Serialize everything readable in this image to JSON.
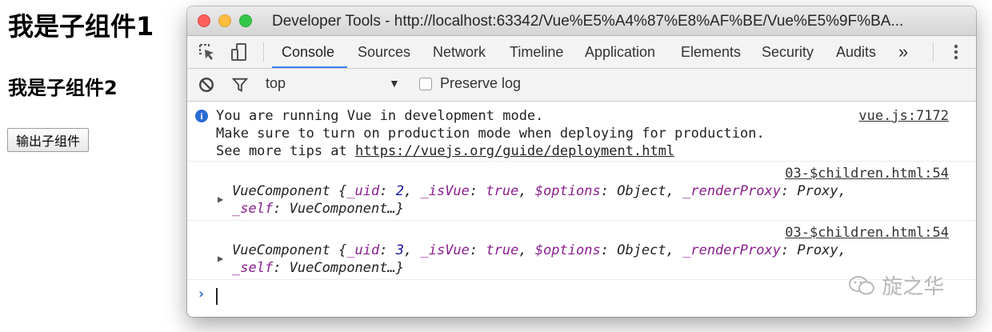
{
  "page": {
    "heading1": "我是子组件1",
    "heading2": "我是子组件2",
    "button_label": "输出子组件"
  },
  "devtools": {
    "window_title": "Developer Tools - http://localhost:63342/Vue%E5%A4%87%E8%AF%BE/Vue%E5%9F%BA...",
    "tabs": [
      "Console",
      "Sources",
      "Network",
      "Timeline",
      "Application",
      "Elements",
      "Security",
      "Audits",
      "»"
    ],
    "active_tab": "Console",
    "filter": {
      "context": "top",
      "preserve_log_label": "Preserve log",
      "preserve_log_checked": false
    },
    "console": {
      "info_message": {
        "lines": [
          "You are running Vue in development mode.",
          "Make sure to turn on production mode when deploying for production."
        ],
        "line3_prefix": "See more tips at ",
        "line3_url": "https://vuejs.org/guide/deployment.html",
        "source": "vue.js:7172"
      },
      "logs": [
        {
          "source": "03-$children.html:54",
          "class_name": "VueComponent",
          "uid_key": "_uid",
          "uid": "2",
          "isvue_key": "_isVue",
          "isvue": "true",
          "options_key": "$options",
          "options": "Object",
          "render_key": "_renderProxy",
          "render": "Proxy",
          "self_key": "_self",
          "self": "VueComponent…}"
        },
        {
          "source": "03-$children.html:54",
          "class_name": "VueComponent",
          "uid_key": "_uid",
          "uid": "3",
          "isvue_key": "_isVue",
          "isvue": "true",
          "options_key": "$options",
          "options": "Object",
          "render_key": "_renderProxy",
          "render": "Proxy",
          "self_key": "_self",
          "self": "VueComponent…}"
        }
      ],
      "prompt_symbol": "›"
    }
  },
  "watermark": "旋之华",
  "icons": {
    "inspect": "element-select-icon",
    "device": "device-mode-icon",
    "clear": "clear-console-icon",
    "filter": "filter-icon",
    "more": "more-vertical-icon",
    "info": "info-icon",
    "wechat": "wechat-logo-icon"
  },
  "colors": {
    "accent": "#3e82f7",
    "info_icon": "#2a6bd3",
    "object_key": "#8a1f8f",
    "number": "#1c16a5"
  }
}
